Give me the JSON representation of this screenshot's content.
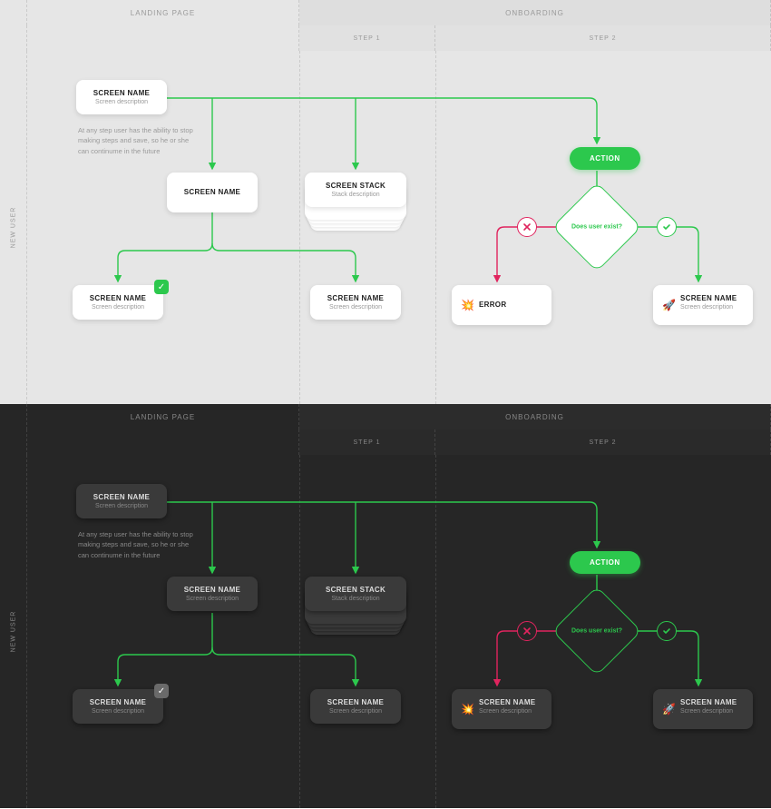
{
  "columns": {
    "landing": "LANDING PAGE",
    "onboarding": "ONBOARDING",
    "step1": "STEP 1",
    "step2": "STEP 2"
  },
  "lane": "NEW USER",
  "note": "At any step user has the ability to stop making steps and save, so he or she can continume in the future",
  "cards": {
    "start": {
      "title": "SCREEN NAME",
      "desc": "Screen description"
    },
    "mid": {
      "title": "SCREEN NAME"
    },
    "stack": {
      "title": "SCREEN STACK",
      "desc": "Stack description"
    },
    "left": {
      "title": "SCREEN NAME",
      "desc": "Screen description"
    },
    "right": {
      "title": "SCREEN NAME",
      "desc": "Screen description"
    },
    "error": {
      "title": "ERROR"
    },
    "success": {
      "title": "SCREEN NAME",
      "desc": "Screen description"
    }
  },
  "action": "ACTION",
  "decision": "Does user exist?",
  "icons": {
    "check": "✓",
    "error": "💥",
    "success": "🚀"
  },
  "colors": {
    "green": "#2cc84d",
    "red": "#e0245e"
  }
}
